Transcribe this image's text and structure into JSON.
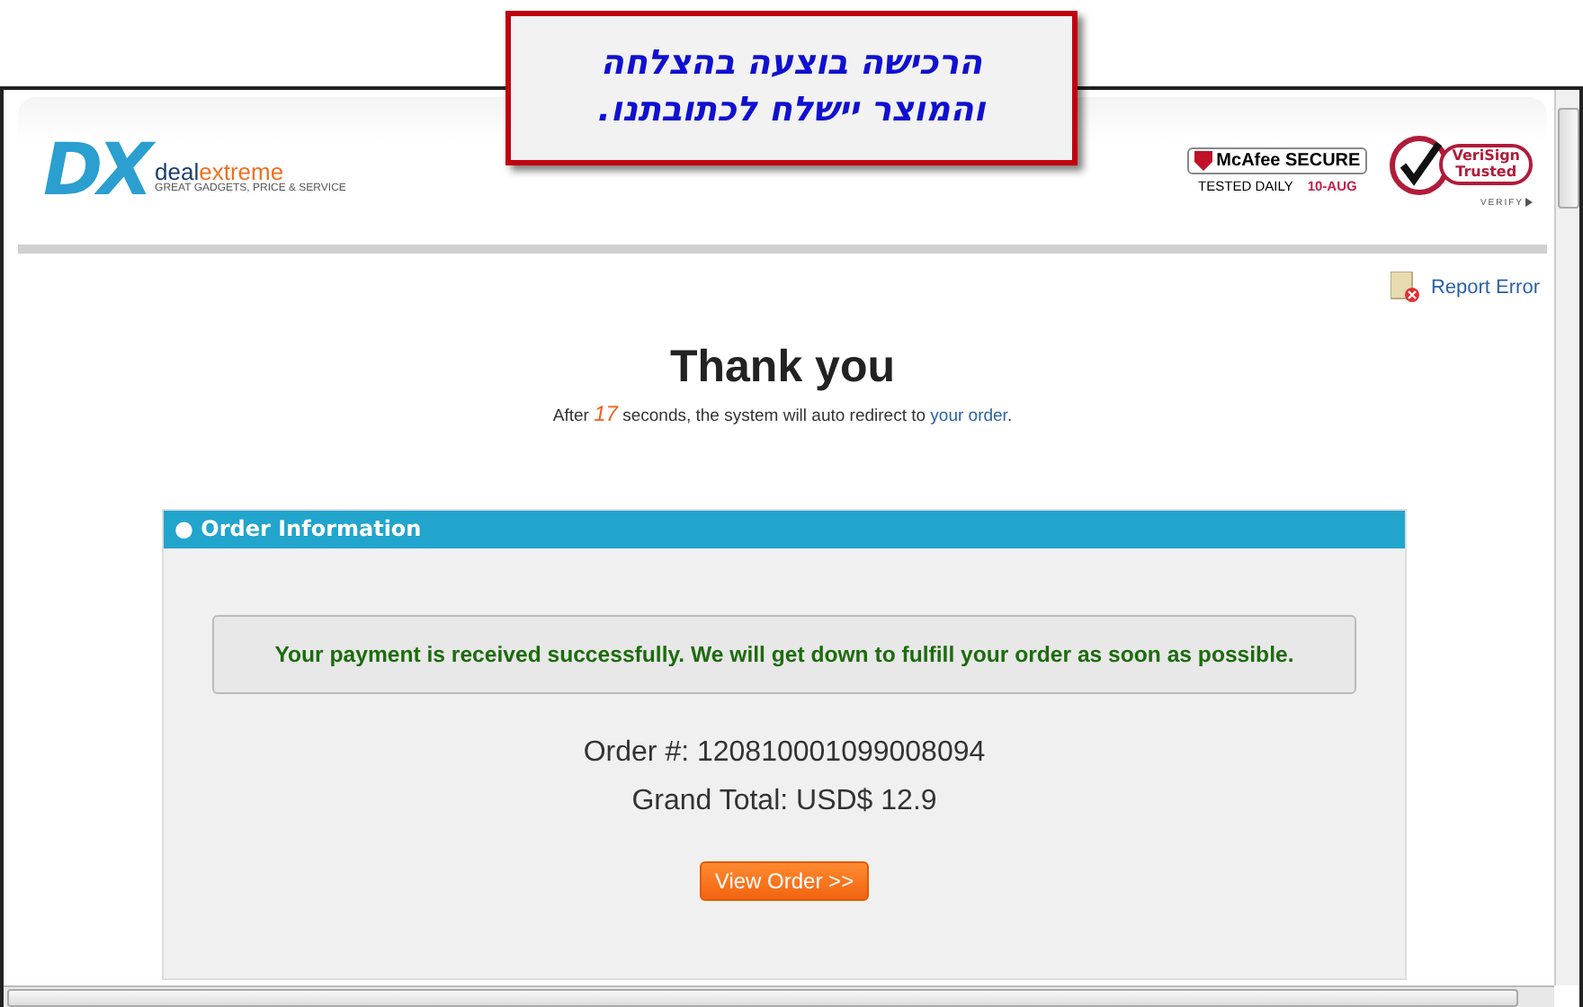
{
  "callout": {
    "lines": [
      "הרכישה בוצעה בהצלחה",
      "והמוצר יישלח לכתובתנו."
    ]
  },
  "header": {
    "logo": {
      "mark": "DX",
      "name_part_1": "deal",
      "name_part_2": "extreme",
      "tagline": "GREAT GADGETS, PRICE & SERVICE"
    },
    "mcafee": {
      "title": "McAfee SECURE",
      "tested": "TESTED DAILY",
      "date": "10-AUG"
    },
    "verisign": {
      "line_1": "VeriSign",
      "line_2": "Trusted",
      "verify": "VERIFY"
    }
  },
  "report_error": "Report Error",
  "heading": "Thank you",
  "redirect": {
    "before": "After",
    "seconds": "17",
    "middle": "seconds, the system will auto redirect to",
    "link": "your order",
    "after": "."
  },
  "panel": {
    "title": "● Order Information",
    "message": "Your payment is received successfully. We will get down to fulfill your order as soon as possible.",
    "order_number": "Order #: 120810001099008094",
    "grand_total": "Grand Total: USD$ 12.9",
    "button": "View Order >>"
  }
}
